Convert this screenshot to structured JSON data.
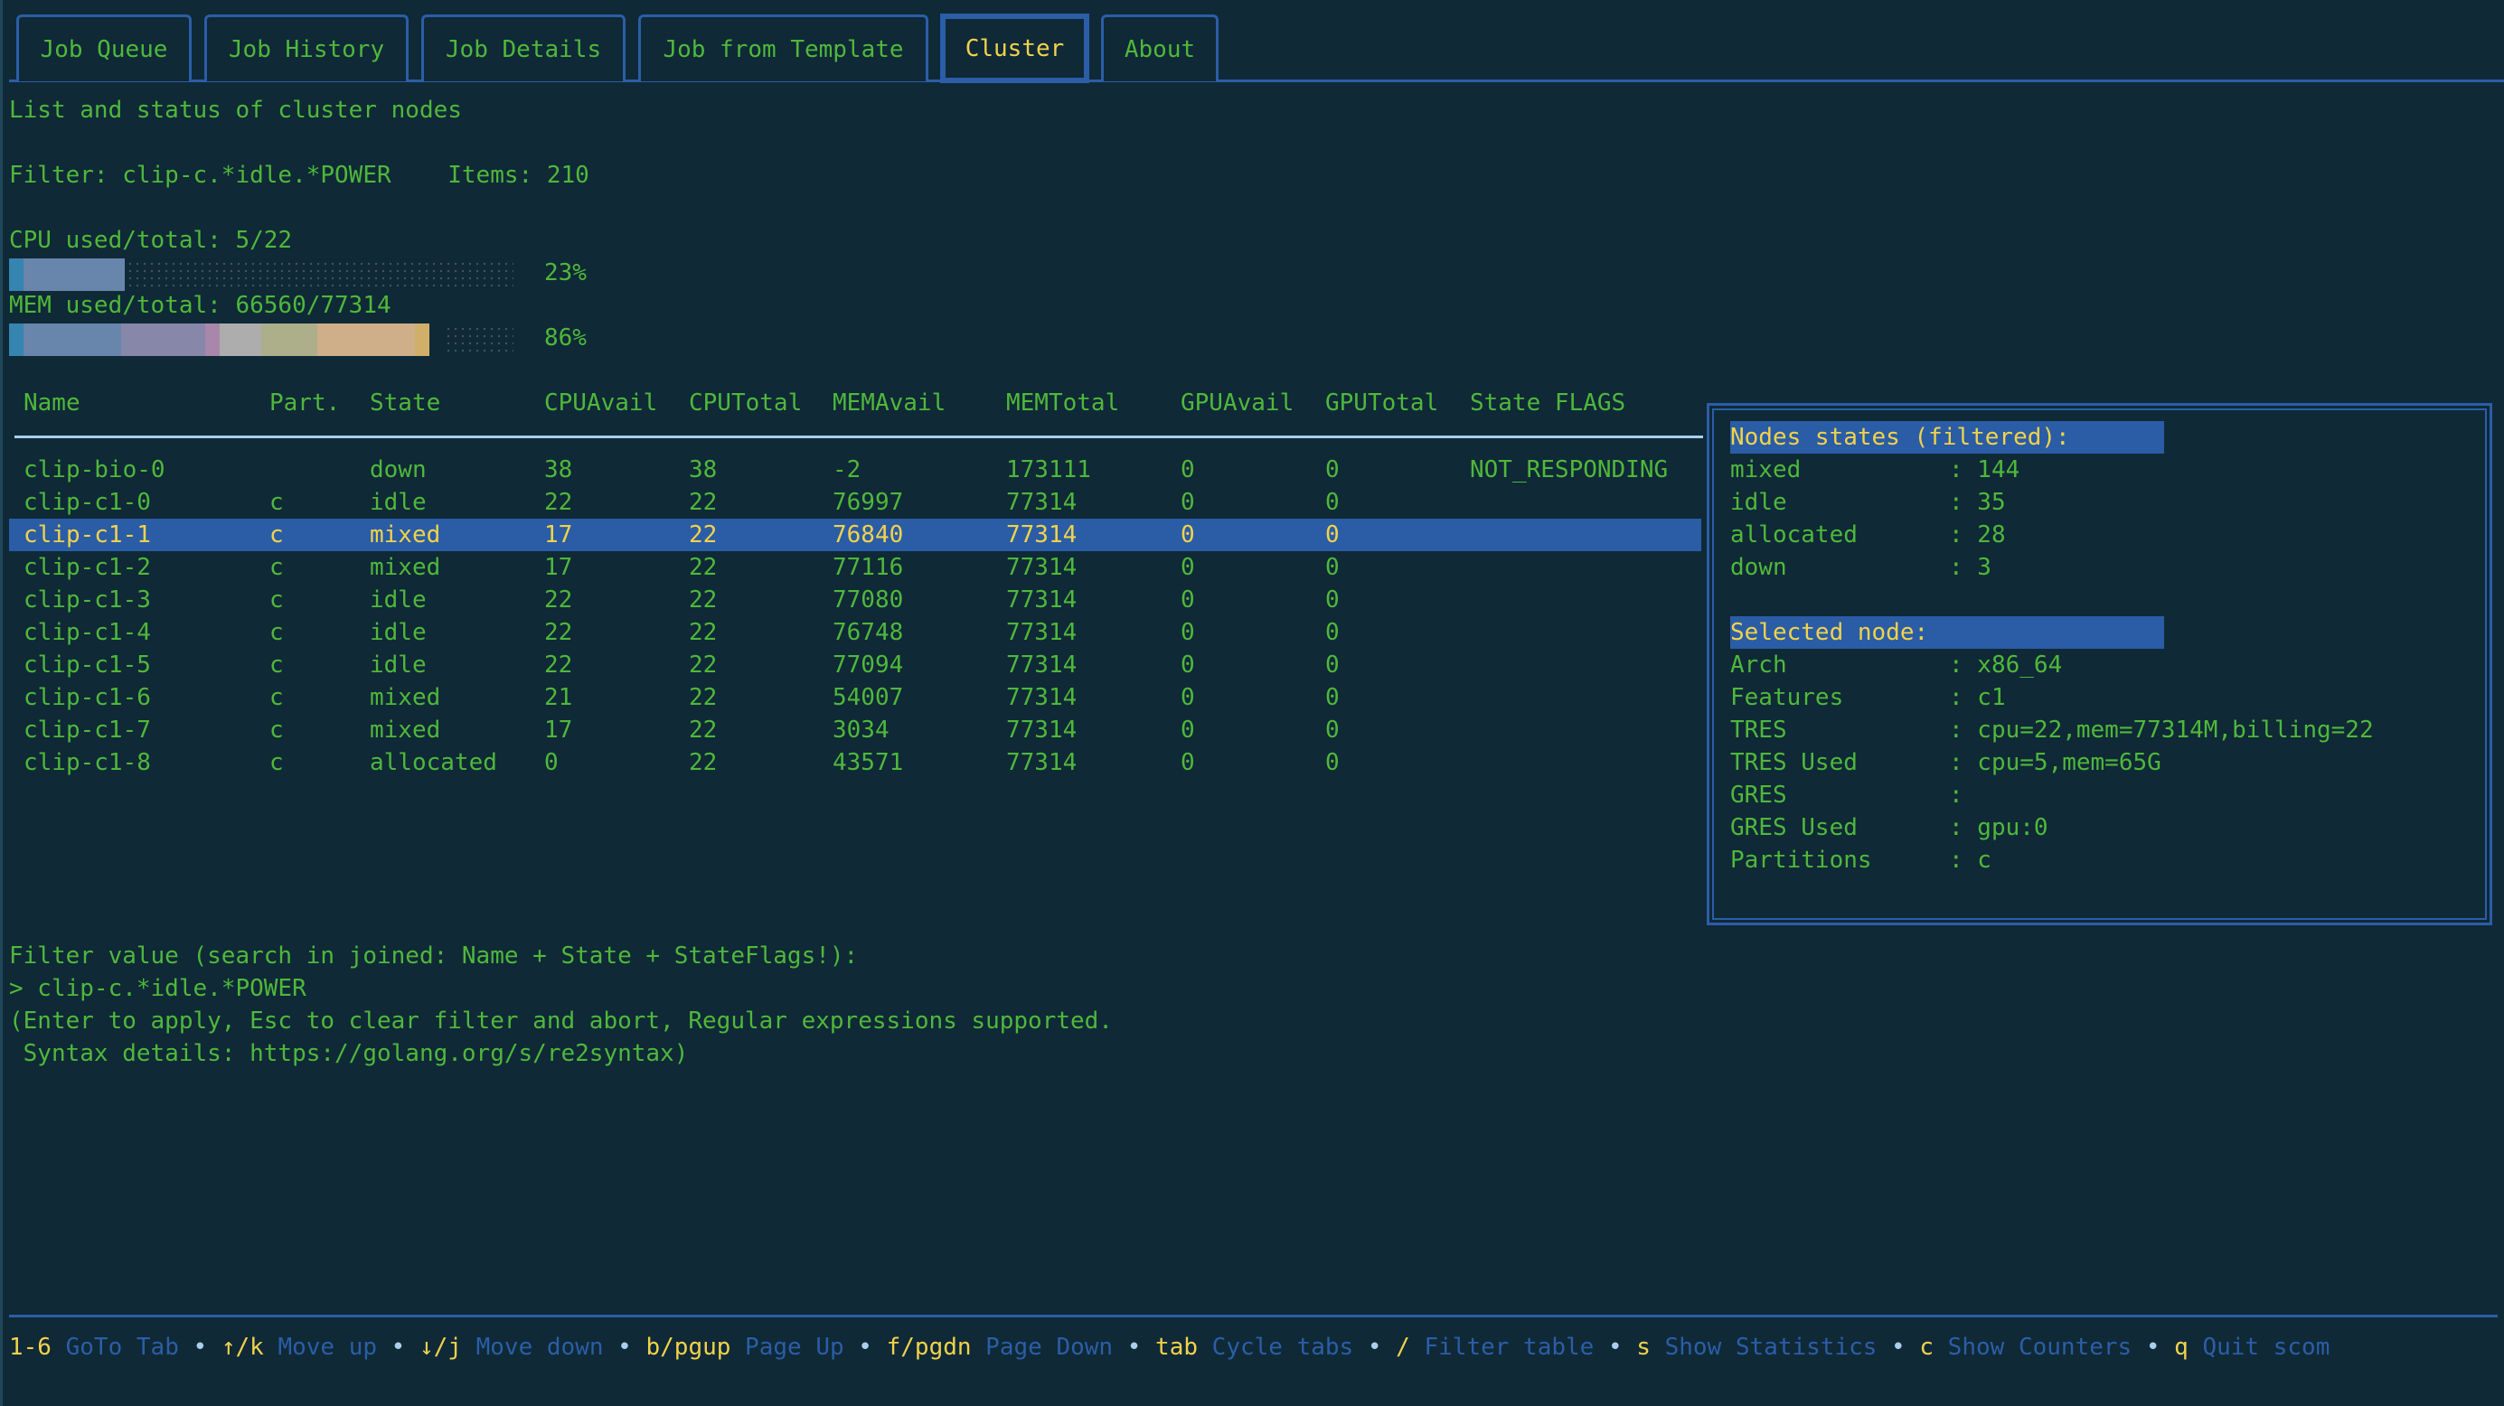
{
  "tabs": [
    {
      "label": "Job Queue",
      "active": false
    },
    {
      "label": "Job History",
      "active": false
    },
    {
      "label": "Job Details",
      "active": false
    },
    {
      "label": "Job from Template",
      "active": false
    },
    {
      "label": "Cluster",
      "active": true
    },
    {
      "label": "About",
      "active": false
    }
  ],
  "page": {
    "subtitle": "List and status of cluster nodes",
    "filter_line": "Filter: clip-c.*idle.*POWER    Items: 210",
    "cpu_label": "CPU used/total: 5/22",
    "cpu_percent_label": "23%",
    "cpu_fraction": 0.23,
    "mem_label": "MEM used/total: 66560/77314",
    "mem_percent_label": "86%",
    "mem_fraction": 0.86
  },
  "bar_colors": {
    "cpu_segments": [
      {
        "color": "#3585b0",
        "share": 0.029
      },
      {
        "color": "#6886ab",
        "share": 0.201
      }
    ],
    "mem_segments": [
      {
        "color": "#3585b0",
        "share": 0.029
      },
      {
        "color": "#6886ab",
        "share": 0.193
      },
      {
        "color": "#8787aa",
        "share": 0.166
      },
      {
        "color": "#a887aa",
        "share": 0.028
      },
      {
        "color": "#adadad",
        "share": 0.083
      },
      {
        "color": "#adae8a",
        "share": 0.111
      },
      {
        "color": "#cfae8a",
        "share": 0.193
      },
      {
        "color": "#d0af6a",
        "share": 0.028
      }
    ]
  },
  "table": {
    "columns": [
      "Name",
      "Part.",
      "State",
      "CPUAvail",
      "CPUTotal",
      "MEMAvail",
      "MEMTotal",
      "GPUAvail",
      "GPUTotal",
      "State FLAGS"
    ],
    "rows": [
      [
        "clip-bio-0",
        "",
        "down",
        "38",
        "38",
        "-2",
        "173111",
        "0",
        "0",
        "NOT_RESPONDING"
      ],
      [
        "clip-c1-0",
        "c",
        "idle",
        "22",
        "22",
        "76997",
        "77314",
        "0",
        "0",
        ""
      ],
      [
        "clip-c1-1",
        "c",
        "mixed",
        "17",
        "22",
        "76840",
        "77314",
        "0",
        "0",
        ""
      ],
      [
        "clip-c1-2",
        "c",
        "mixed",
        "17",
        "22",
        "77116",
        "77314",
        "0",
        "0",
        ""
      ],
      [
        "clip-c1-3",
        "c",
        "idle",
        "22",
        "22",
        "77080",
        "77314",
        "0",
        "0",
        ""
      ],
      [
        "clip-c1-4",
        "c",
        "idle",
        "22",
        "22",
        "76748",
        "77314",
        "0",
        "0",
        ""
      ],
      [
        "clip-c1-5",
        "c",
        "idle",
        "22",
        "22",
        "77094",
        "77314",
        "0",
        "0",
        ""
      ],
      [
        "clip-c1-6",
        "c",
        "mixed",
        "21",
        "22",
        "54007",
        "77314",
        "0",
        "0",
        ""
      ],
      [
        "clip-c1-7",
        "c",
        "mixed",
        "17",
        "22",
        "3034",
        "77314",
        "0",
        "0",
        ""
      ],
      [
        "clip-c1-8",
        "c",
        "allocated",
        "0",
        "22",
        "43571",
        "77314",
        "0",
        "0",
        ""
      ]
    ],
    "selected_index": 2
  },
  "panel": {
    "states_title": "Nodes states (filtered):",
    "states": [
      {
        "k": "mixed",
        "v": ": 144"
      },
      {
        "k": "idle",
        "v": ": 35"
      },
      {
        "k": "allocated",
        "v": ": 28"
      },
      {
        "k": "down",
        "v": ": 3"
      }
    ],
    "node_title": "Selected node:",
    "node": [
      {
        "k": "Arch",
        "v": ": x86_64"
      },
      {
        "k": "Features",
        "v": ": c1"
      },
      {
        "k": "TRES",
        "v": ": cpu=22,mem=77314M,billing=22"
      },
      {
        "k": "TRES Used",
        "v": ": cpu=5,mem=65G"
      },
      {
        "k": "GRES",
        "v": ":"
      },
      {
        "k": "GRES Used",
        "v": ": gpu:0"
      },
      {
        "k": "Partitions",
        "v": ": c"
      }
    ]
  },
  "filter_prompt": {
    "label": "Filter value (search in joined: Name + State + StateFlags!):",
    "input_value": "> clip-c.*idle.*POWER",
    "help_1": "(Enter to apply, Esc to clear filter and abort, Regular expressions supported.",
    "help_2": " Syntax details: https://golang.org/s/re2syntax)"
  },
  "footer": {
    "shortcuts": [
      {
        "key": "1-6",
        "desc": "GoTo Tab"
      },
      {
        "key": "↑/k",
        "desc": "Move up"
      },
      {
        "key": "↓/j",
        "desc": "Move down"
      },
      {
        "key": "b/pgup",
        "desc": "Page Up"
      },
      {
        "key": "f/pgdn",
        "desc": "Page Down"
      },
      {
        "key": "tab",
        "desc": "Cycle tabs"
      },
      {
        "key": "/",
        "desc": "Filter table"
      },
      {
        "key": "s",
        "desc": "Show Statistics"
      },
      {
        "key": "c",
        "desc": "Show Counters"
      },
      {
        "key": "q",
        "desc": "Quit scom"
      }
    ],
    "separator": "•"
  }
}
